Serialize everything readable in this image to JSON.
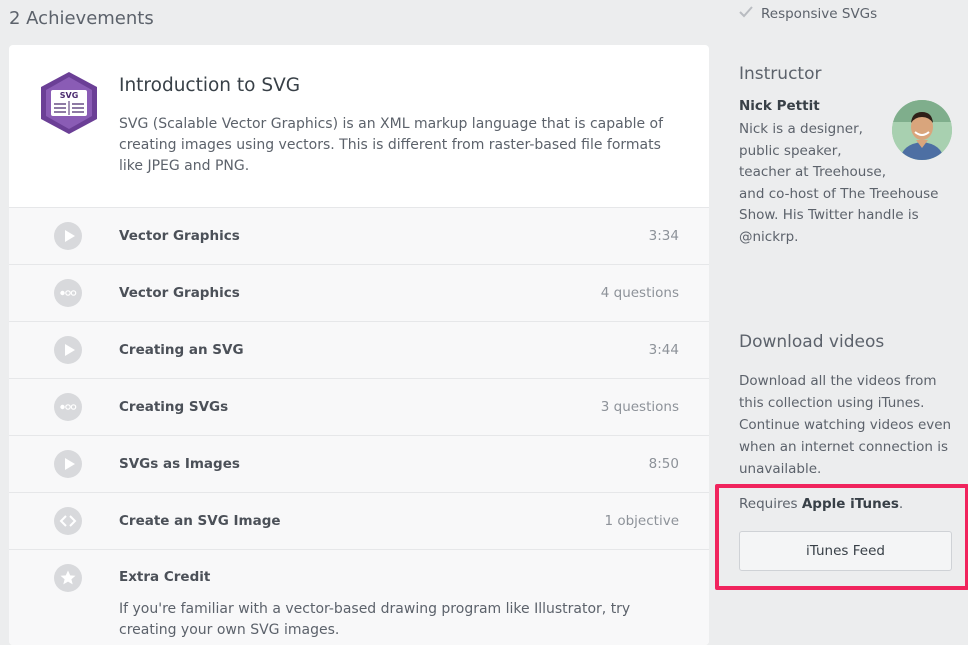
{
  "achievements": {
    "title": "2 Achievements"
  },
  "course": {
    "badge_text": "SVG",
    "title": "Introduction to SVG",
    "description": "SVG (Scalable Vector Graphics) is an XML markup language that is capable of creating images using vectors. This is different from raster-based file formats like JPEG and PNG."
  },
  "steps": [
    {
      "type": "video",
      "icon": "play-icon",
      "label": "Vector Graphics",
      "meta": "3:34"
    },
    {
      "type": "quiz",
      "icon": "quiz-dots-icon",
      "label": "Vector Graphics",
      "meta": "4 questions"
    },
    {
      "type": "video",
      "icon": "play-icon",
      "label": "Creating an SVG",
      "meta": "3:44"
    },
    {
      "type": "quiz",
      "icon": "quiz-dots-icon",
      "label": "Creating SVGs",
      "meta": "3 questions"
    },
    {
      "type": "video",
      "icon": "play-icon",
      "label": "SVGs as Images",
      "meta": "8:50"
    },
    {
      "type": "code",
      "icon": "code-challenge-icon",
      "label": "Create an SVG Image",
      "meta": "1 objective"
    }
  ],
  "extra_credit": {
    "icon": "star-icon",
    "label": "Extra Credit",
    "description": "If you're familiar with a vector-based drawing program like Illustrator, try creating your own SVG images."
  },
  "sidebar": {
    "completed_item": "Responsive SVGs",
    "instructor": {
      "heading": "Instructor",
      "name": "Nick Pettit",
      "bio": "Nick is a designer, public speaker, teacher at Treehouse, and co-host of The Treehouse Show. His Twitter handle is @nickrp."
    },
    "download": {
      "heading": "Download videos",
      "description": "Download all the videos from this collection using iTunes. Continue watching videos even when an internet connection is unavailable.",
      "requires_prefix": "Requires",
      "requires_app": "Apple iTunes",
      "requires_suffix": ".",
      "button_label": "iTunes Feed"
    }
  },
  "colors": {
    "background": "#ecedee",
    "card": "#ffffff",
    "badge_purple": "#6b3f96",
    "highlight": "#f0245d",
    "step_icon": "#d8d9dc"
  }
}
